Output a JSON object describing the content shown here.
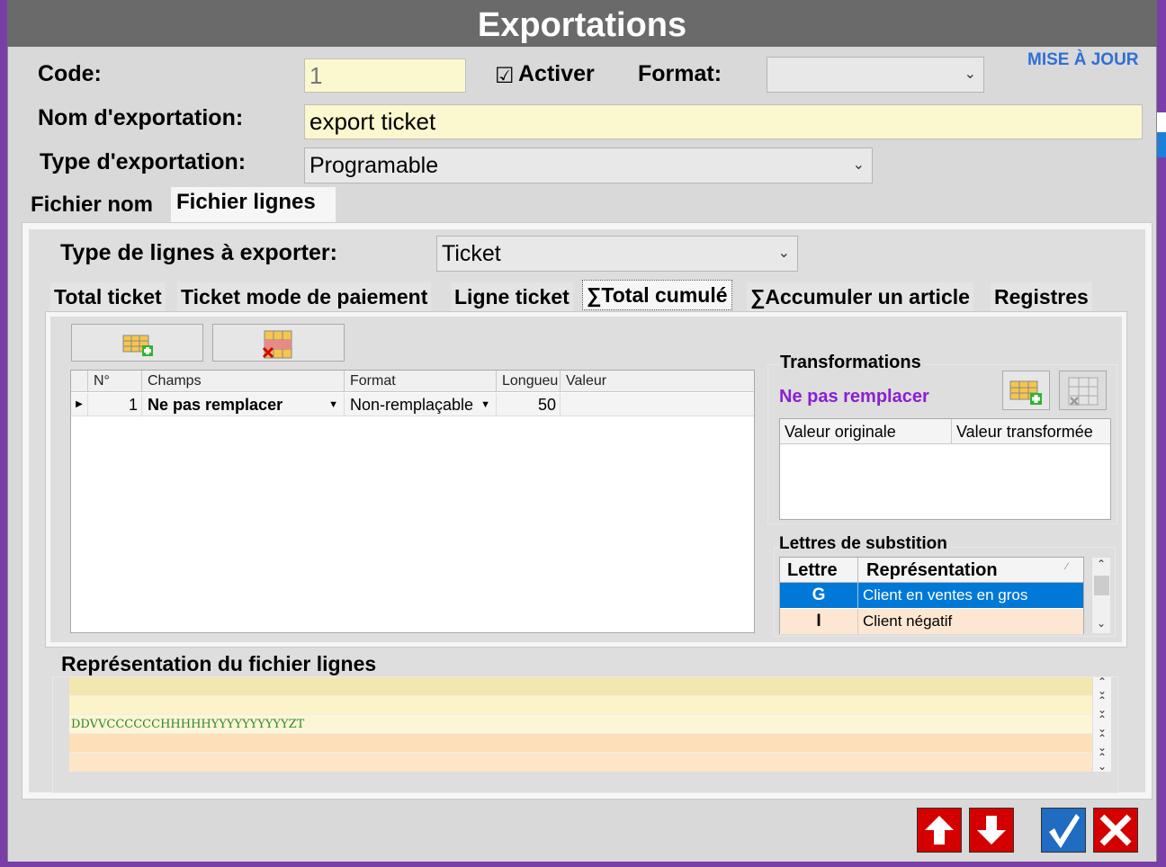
{
  "window": {
    "title": "Exportations",
    "update_link": "MISE À JOUR"
  },
  "form": {
    "code_label": "Code:",
    "code_value": "1",
    "activate_label": "Activer",
    "activate_checked": true,
    "format_label": "Format:",
    "format_value": "",
    "name_label": "Nom d'exportation:",
    "name_value": "export ticket",
    "type_label": "Type d'exportation:",
    "type_value": "Programable"
  },
  "outer_tabs": [
    {
      "label": "Fichier nom",
      "selected": false
    },
    {
      "label": "Fichier lignes",
      "selected": true
    }
  ],
  "lines": {
    "type_label": "Type de lignes à exporter:",
    "type_value": "Ticket"
  },
  "inner_tabs": [
    {
      "label": "Total ticket",
      "selected": false
    },
    {
      "label": "Ticket mode de paiement",
      "selected": false
    },
    {
      "label": "Ligne ticket",
      "selected": false
    },
    {
      "label": "∑Total cumulé",
      "selected": true
    },
    {
      "label": "∑Accumuler un article",
      "selected": false
    },
    {
      "label": "Registres",
      "selected": false
    }
  ],
  "fields_grid": {
    "columns": [
      "N°",
      "Champs",
      "Format",
      "Longueu",
      "Valeur"
    ],
    "rows": [
      {
        "num": "1",
        "champs": "Ne pas remplacer",
        "format": "Non-remplaçable",
        "longueur": "50",
        "valeur": ""
      }
    ]
  },
  "transformations": {
    "title": "Transformations",
    "current": "Ne pas remplacer",
    "columns": [
      "Valeur originale",
      "Valeur transformée"
    ]
  },
  "substitution": {
    "title": "Lettres de substition",
    "columns": [
      "Lettre",
      "Représentation"
    ],
    "rows": [
      {
        "letter": "G",
        "text": "Client en ventes en gros",
        "selected": true
      },
      {
        "letter": "I",
        "text": "Client négatif",
        "selected": false
      }
    ]
  },
  "representation": {
    "title": "Représentation du fichier lignes",
    "lines": [
      "",
      "",
      "DDVVCCCCCCHHHHHYYYYYYYYYYZT",
      "",
      ""
    ]
  },
  "colors": {
    "accent_blue": "#0078d7",
    "purple_text": "#8a1fd1",
    "link_blue": "#2f6fd6",
    "nav_red": "#d40000",
    "confirm_blue": "#1f6cc2"
  }
}
